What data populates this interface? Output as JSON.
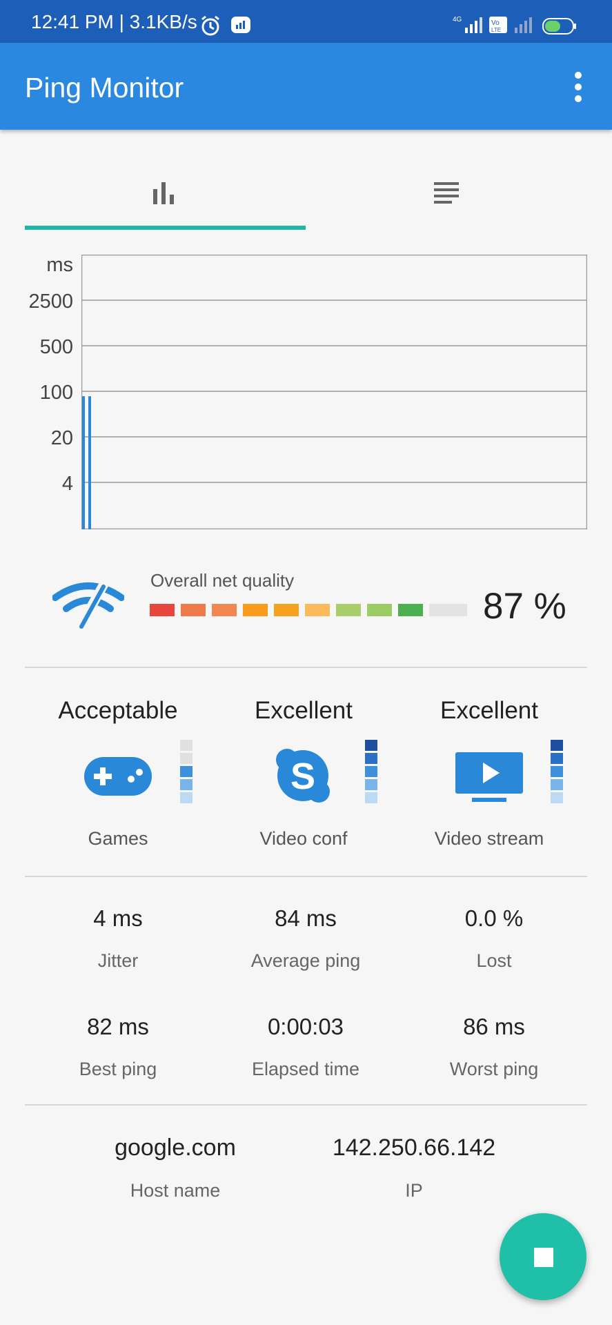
{
  "status_bar": {
    "time_speed": "12:41 PM | 3.1KB/s"
  },
  "app_bar": {
    "title": "Ping Monitor"
  },
  "tabs": [
    {
      "icon": "bar-chart-icon",
      "selected": true
    },
    {
      "icon": "list-icon",
      "selected": false
    }
  ],
  "chart_data": {
    "type": "bar",
    "ylabel": "ms",
    "yscale": "log",
    "yticks": [
      "2500",
      "500",
      "100",
      "20",
      "4"
    ],
    "values": [
      84,
      84
    ],
    "grid": true
  },
  "quality": {
    "label": "Overall net quality",
    "value_text": "87 %",
    "value": 87,
    "segment_colors": [
      "#e8453c",
      "#f07a4a",
      "#f28650",
      "#f89a1c",
      "#f7a21e",
      "#fbba5c",
      "#a8cf6a",
      "#9ccd64",
      "#4caf50",
      "#e3e3e3"
    ]
  },
  "ratings": [
    {
      "title": "Acceptable",
      "caption": "Games",
      "icon": "gamepad-icon",
      "level": 3
    },
    {
      "title": "Excellent",
      "caption": "Video conf",
      "icon": "skype-icon",
      "level": 5
    },
    {
      "title": "Excellent",
      "caption": "Video stream",
      "icon": "tv-play-icon",
      "level": 5
    }
  ],
  "stats": {
    "jitter": {
      "value": "4 ms",
      "label": "Jitter"
    },
    "avg_ping": {
      "value": "84 ms",
      "label": "Average ping"
    },
    "lost": {
      "value": "0.0 %",
      "label": "Lost"
    },
    "best_ping": {
      "value": "82 ms",
      "label": "Best ping"
    },
    "elapsed": {
      "value": "0:00:03",
      "label": "Elapsed time"
    },
    "worst_ping": {
      "value": "86 ms",
      "label": "Worst ping"
    }
  },
  "host": {
    "name": "google.com",
    "name_label": "Host name",
    "ip": "142.250.66.142",
    "ip_label": "IP"
  },
  "colors": {
    "accent": "#1fb6a4",
    "primary": "#2a88e0",
    "bar": "#2a88d8"
  }
}
